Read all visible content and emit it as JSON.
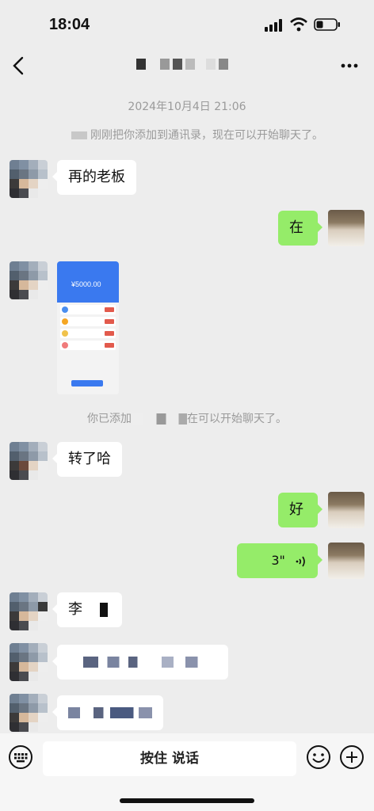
{
  "status_bar": {
    "time": "18:04"
  },
  "chat": {
    "timestamp": "2024年10月4日 21:06",
    "system_added": "刚刚把你添加到通讯录，现在可以开始聊天了。",
    "system_added_2_prefix": "你已添加",
    "system_added_2_suffix": "在可以开始聊天了。",
    "messages": {
      "m1": "再的老板",
      "m2": "在",
      "m4": "转了哈",
      "m5": "好",
      "m6_duration": "3\"",
      "m7": "李",
      "screenshot_amount": "¥5000.00"
    }
  },
  "input_bar": {
    "hold_to_talk": "按住 说话"
  },
  "icons": [
    "back-icon",
    "more-icon",
    "keyboard-icon",
    "emoji-icon",
    "plus-icon",
    "voice-wave-icon"
  ]
}
